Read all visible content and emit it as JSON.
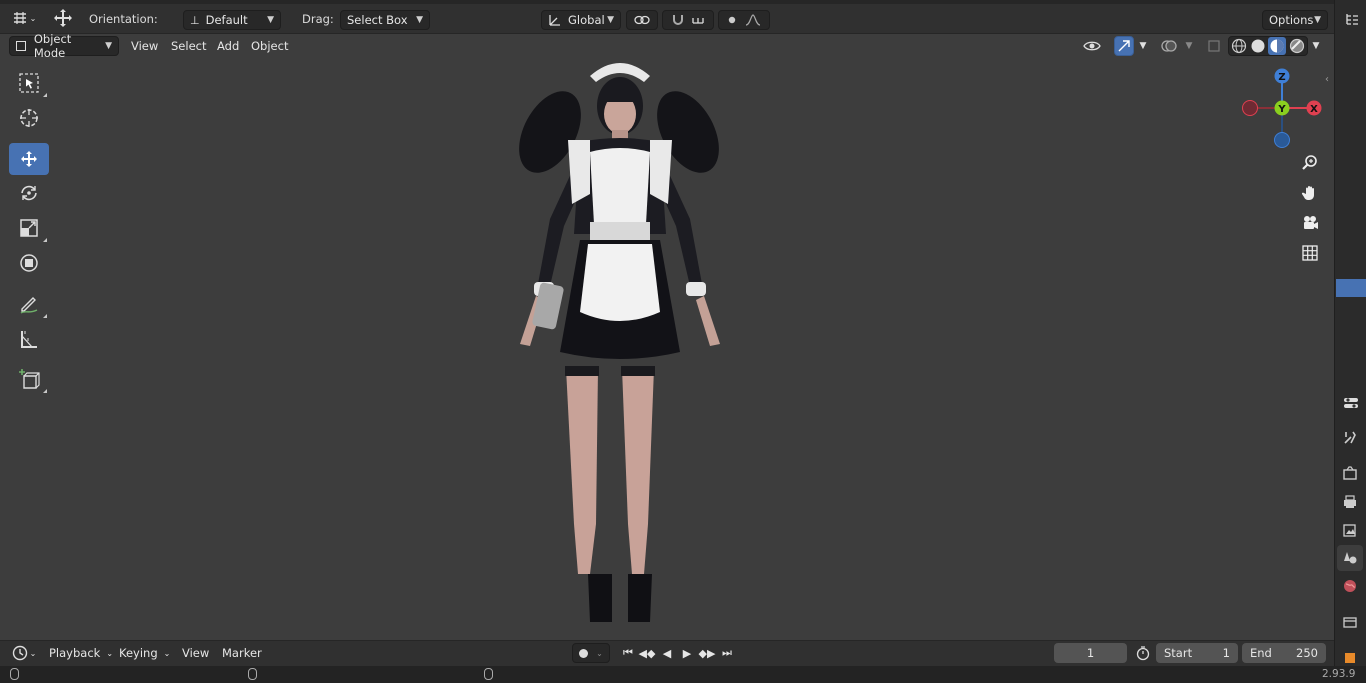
{
  "header": {
    "orientation_label": "Orientation:",
    "orientation_value": "Default",
    "drag_label": "Drag:",
    "drag_value": "Select Box",
    "transform_space": "Global",
    "options_label": "Options"
  },
  "viewport_header": {
    "mode": "Object Mode",
    "menus": [
      "View",
      "Select",
      "Add",
      "Object"
    ]
  },
  "gizmo": {
    "z": "Z",
    "y": "Y",
    "x": "X"
  },
  "timeline": {
    "menus": [
      "Playback",
      "Keying",
      "View",
      "Marker"
    ],
    "current_frame": "1",
    "start_label": "Start",
    "start_value": "1",
    "end_label": "End",
    "end_value": "250"
  },
  "status": {
    "version": "2.93.9"
  },
  "colors": {
    "accent": "#4772b3",
    "viewport_bg": "#3d3d3d",
    "gizmo_x": "#e04050",
    "gizmo_y": "#8acf1f",
    "gizmo_z": "#3f7fd6"
  }
}
